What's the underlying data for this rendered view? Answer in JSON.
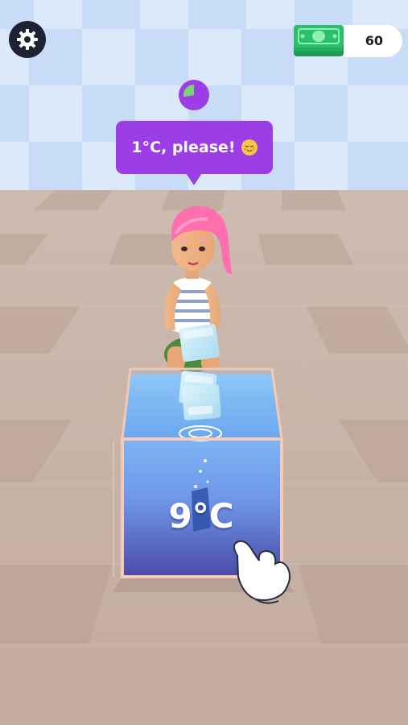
{
  "hud": {
    "settings_icon": "gear-icon",
    "cash_icon": "cash-stack-icon",
    "cash_amount": "60"
  },
  "customer": {
    "order_text": "1°C, please!",
    "order_emoji": "relieved-face",
    "patience_remaining": 0.28
  },
  "tank": {
    "temperature_text": "9°C"
  },
  "colors": {
    "bubble": "#9b3ee6",
    "water": "#5a8be6",
    "hair": "#ff6fae",
    "cash": "#2bbf6a"
  }
}
